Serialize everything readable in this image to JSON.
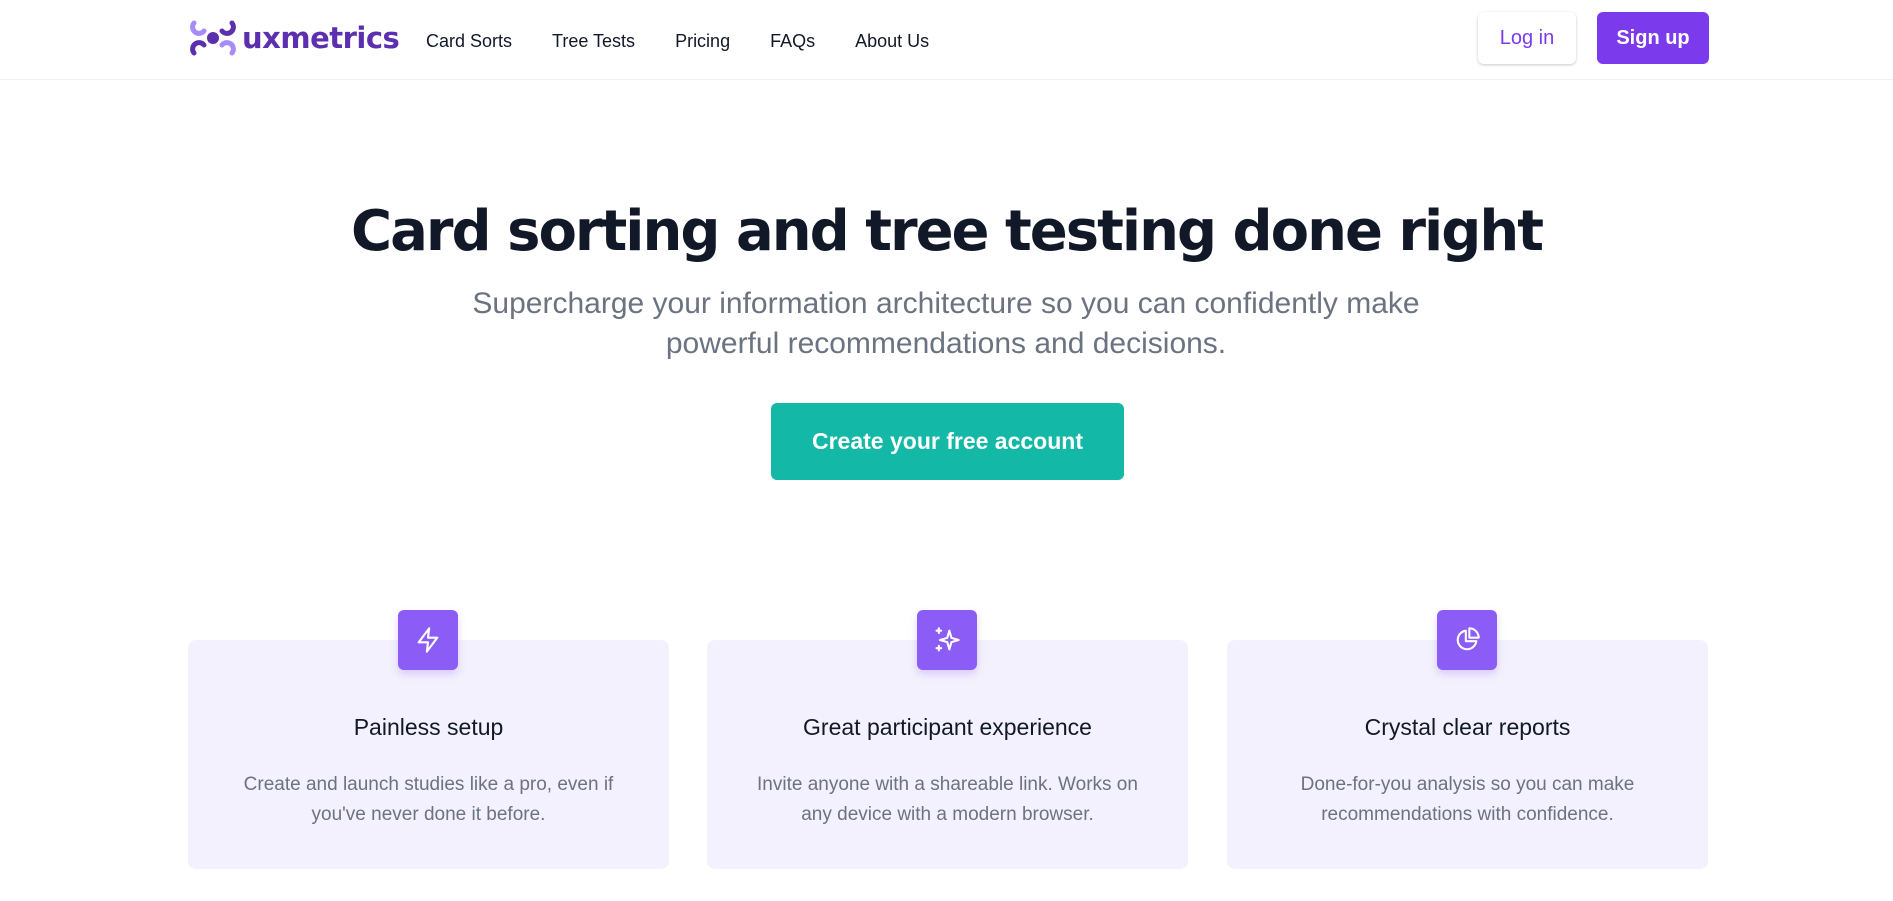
{
  "brand": {
    "name": "uxmetrics",
    "logo_icon": "uxmetrics-logo-icon",
    "color": "#5b2fae"
  },
  "nav": {
    "items": [
      {
        "label": "Card Sorts"
      },
      {
        "label": "Tree Tests"
      },
      {
        "label": "Pricing"
      },
      {
        "label": "FAQs"
      },
      {
        "label": "About Us"
      }
    ]
  },
  "auth": {
    "login_label": "Log in",
    "signup_label": "Sign up"
  },
  "hero": {
    "title": "Card sorting and tree testing done right",
    "subtitle": "Supercharge your information architecture so you can confidently make powerful recommendations and decisions.",
    "cta_label": "Create your free account"
  },
  "features": [
    {
      "icon": "lightning-bolt-icon",
      "title": "Painless setup",
      "description": "Create and launch studies like a pro, even if you've never done it before."
    },
    {
      "icon": "sparkles-icon",
      "title": "Great participant experience",
      "description": "Invite anyone with a shareable link. Works on any device with a modern browser."
    },
    {
      "icon": "pie-chart-icon",
      "title": "Crystal clear reports",
      "description": "Done-for-you analysis so you can make recommendations with confidence."
    }
  ],
  "colors": {
    "primary": "#7c3aed",
    "accent": "#14b8a6",
    "icon_bg": "#8b5cf6",
    "card_bg": "#f3f1fd"
  }
}
